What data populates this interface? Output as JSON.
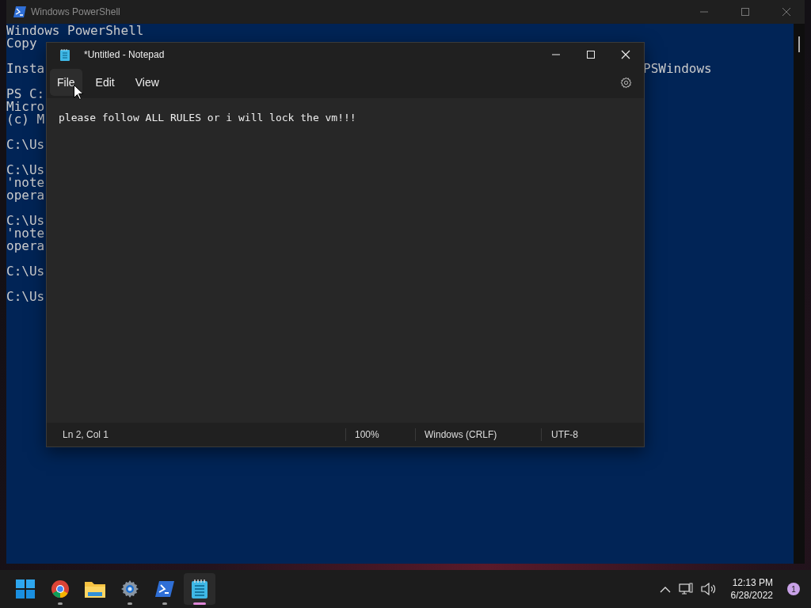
{
  "console_window": {
    "title": "Windows PowerShell",
    "blocks": [
      {
        "lines": [
          {
            "left": "Windows PowerShell"
          },
          {
            "left": "Copy"
          }
        ]
      },
      {
        "lines": [
          {
            "left": "Insta",
            "right": "PSWindows"
          }
        ]
      },
      {
        "lines": [
          {
            "left": "PS C:"
          },
          {
            "left": "Micro"
          },
          {
            "left": "(c) M"
          }
        ]
      },
      {
        "lines": [
          {
            "left": "C:\\Us"
          }
        ]
      },
      {
        "lines": [
          {
            "left": "C:\\Us"
          },
          {
            "left": "'note"
          },
          {
            "left": "opera"
          }
        ]
      },
      {
        "lines": [
          {
            "left": "C:\\Us"
          },
          {
            "left": "'note"
          },
          {
            "left": "opera"
          }
        ]
      },
      {
        "lines": [
          {
            "left": "C:\\Us"
          }
        ]
      },
      {
        "lines": [
          {
            "left": "C:\\Us"
          }
        ]
      }
    ]
  },
  "notepad": {
    "title": "*Untitled - Notepad",
    "menu": [
      {
        "label": "File",
        "hovered": true
      },
      {
        "label": "Edit",
        "hovered": false
      },
      {
        "label": "View",
        "hovered": false
      }
    ],
    "text": "please follow ALL RULES or i will lock the vm!!!",
    "status_bar": [
      "Ln 2, Col 1",
      "100%",
      "Windows (CRLF)",
      "UTF-8"
    ]
  },
  "taskbar": {
    "apps": [
      {
        "kind": "start",
        "running": false,
        "selected": false
      },
      {
        "kind": "browser",
        "running": true,
        "selected": false
      },
      {
        "kind": "folder",
        "running": false,
        "selected": false
      },
      {
        "kind": "settings",
        "running": true,
        "selected": false
      },
      {
        "kind": "terminal",
        "running": true,
        "selected": false
      },
      {
        "kind": "notepad",
        "running": true,
        "selected": true
      }
    ],
    "time": "12:13 PM",
    "date": "6/28/2022",
    "notification_count": "1"
  }
}
